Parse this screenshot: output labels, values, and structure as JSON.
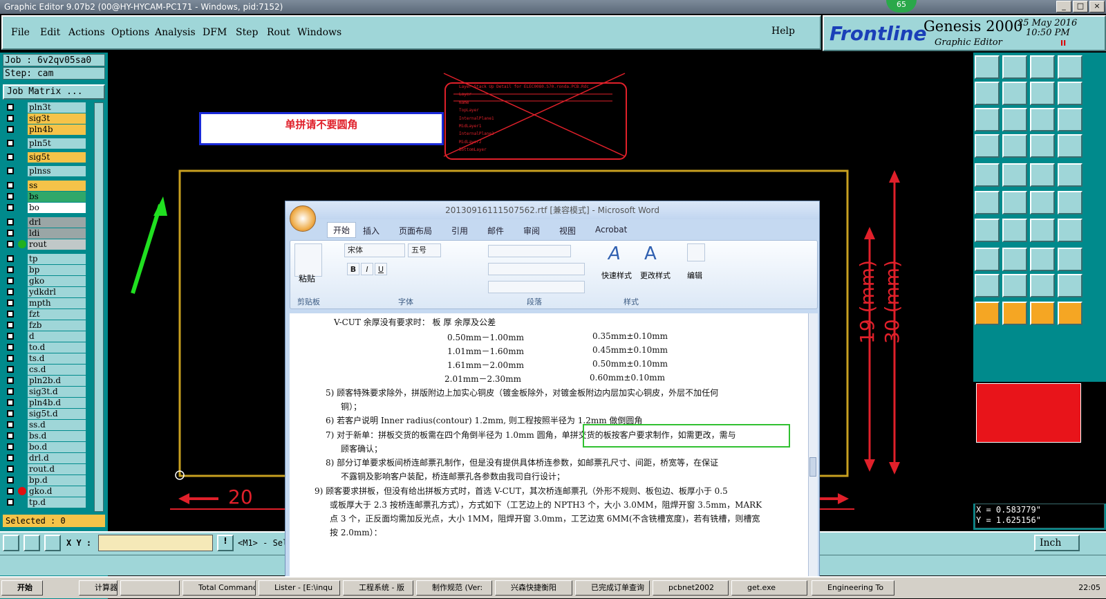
{
  "window": {
    "title": "Graphic Editor 9.07b2 (00@HY-HYCAM-PC171 - Windows, pid:7152)",
    "badge": "65",
    "min": "_",
    "max": "□",
    "close": "×"
  },
  "menu": {
    "items": [
      "File",
      "Edit",
      "Actions",
      "Options",
      "Analysis",
      "DFM",
      "Step",
      "Rout",
      "Windows"
    ],
    "help": "Help"
  },
  "brand": {
    "logo": "Frontline",
    "product": "Genesis 2000",
    "sub": "Graphic Editor",
    "date": "25 May 2016",
    "time": "10:50 PM",
    "icon": "II"
  },
  "job": {
    "job_label": "Job : 6v2qv05sa0",
    "step_label": "Step: cam",
    "matrix_button": "Job Matrix ...",
    "selected": "Selected : 0"
  },
  "layers": [
    {
      "name": "pln3t",
      "color": "#9fd6d8"
    },
    {
      "name": "sig3t",
      "color": "#f5c349"
    },
    {
      "name": "pln4b",
      "color": "#f5c349"
    },
    {
      "name": "pln5t",
      "color": "#9fd6d8"
    },
    {
      "name": "sig5t",
      "color": "#f5c349"
    },
    {
      "name": "plnss",
      "color": "#9fd6d8"
    },
    {
      "name": "ss",
      "color": "#f5c349"
    },
    {
      "name": "bs",
      "color": "#2fa86a"
    },
    {
      "name": "bo",
      "color": "#ffffff"
    },
    {
      "name": "drl",
      "color": "#9aa6a6"
    },
    {
      "name": "ldi",
      "color": "#9aa6a6"
    },
    {
      "name": "rout",
      "color": "#c0c8c8"
    },
    {
      "name": "tp",
      "color": "#9fd6d8"
    },
    {
      "name": "bp",
      "color": "#9fd6d8"
    },
    {
      "name": "gko",
      "color": "#9fd6d8"
    },
    {
      "name": "ydkdrl",
      "color": "#9fd6d8"
    },
    {
      "name": "mpth",
      "color": "#9fd6d8"
    },
    {
      "name": "fzt",
      "color": "#9fd6d8"
    },
    {
      "name": "fzb",
      "color": "#9fd6d8"
    },
    {
      "name": "d",
      "color": "#9fd6d8"
    },
    {
      "name": "to.d",
      "color": "#9fd6d8"
    },
    {
      "name": "ts.d",
      "color": "#9fd6d8"
    },
    {
      "name": "cs.d",
      "color": "#9fd6d8"
    },
    {
      "name": "pln2b.d",
      "color": "#9fd6d8"
    },
    {
      "name": "sig3t.d",
      "color": "#9fd6d8"
    },
    {
      "name": "pln4b.d",
      "color": "#9fd6d8"
    },
    {
      "name": "sig5t.d",
      "color": "#9fd6d8"
    },
    {
      "name": "ss.d",
      "color": "#9fd6d8"
    },
    {
      "name": "bs.d",
      "color": "#9fd6d8"
    },
    {
      "name": "bo.d",
      "color": "#9fd6d8"
    },
    {
      "name": "drl.d",
      "color": "#9fd6d8"
    },
    {
      "name": "rout.d",
      "color": "#9fd6d8"
    },
    {
      "name": "bp.d",
      "color": "#9fd6d8"
    },
    {
      "name": "gko.d",
      "color": "#9fd6d8"
    },
    {
      "name": "tp.d",
      "color": "#9fd6d8"
    }
  ],
  "canvas": {
    "note": "单拼请不要圆角",
    "dim_h": "20",
    "dim_v1": "19 (mm)",
    "dim_v2": "30 (mm)",
    "stackup": [
      "Layer Stack Up Detail for ELEC0080.S70.ronda.PCB.Rdc",
      [
        "Layer"
      ],
      [
        "Name"
      ],
      "TopLayer",
      "InternalPlane1",
      "MidLayer1",
      "InternalPlane2",
      "MidLayer2",
      "BottomLayer"
    ]
  },
  "coords": {
    "x": "X = 0.583779\"",
    "y": "Y = 1.625156\""
  },
  "bottom": {
    "xy_label": "X Y :",
    "xy_value": "",
    "status": "<M1> - Sel",
    "units": "Inch"
  },
  "word": {
    "title": "20130916111507562.rtf [兼容模式] - Microsoft Word",
    "tabs": [
      "开始",
      "插入",
      "页面布局",
      "引用",
      "邮件",
      "审阅",
      "视图",
      "Acrobat"
    ],
    "font": "宋体",
    "size": "五号",
    "groups": [
      "剪贴板",
      "字体",
      "段落",
      "样式",
      "编辑"
    ],
    "paste": "粘贴",
    "quick_style": "快速样式",
    "change_style": "更改样式",
    "edit": "编辑",
    "lines": [
      "V-CUT 余厚没有要求时：          板   厚                          余厚及公差",
      "0.50mm－1.00mm",
      "0.35mm±0.10mm",
      "1.01mm－1.60mm",
      "0.45mm±0.10mm",
      "1.61mm－2.00mm",
      "0.50mm±0.10mm",
      "2.01mm－2.30mm",
      "0.60mm±0.10mm",
      "5)   顾客特殊要求除外，拼版附边上加实心铜皮（镀金板除外，对镀金板附边内层加实心铜皮，外层不加任何",
      "铜）；",
      "6)   若客户说明 Inner radius(contour) 1.2mm, 则工程按照半径为 1.2mm 做倒圆角",
      "7)   对于新单：拼板交货的板需在四个角倒半径为 1.0mm 圆角，单拼交货的板按客户要求制作，如需更改，需与",
      "顾客确认；",
      "8)   部分订单要求板间桥连邮票孔制作，但是没有提供具体桥连参数，如邮票孔尺寸、间距，桥宽等，在保证",
      "不露铜及影响客户装配，桥连邮票孔各参数由我司自行设计；",
      "9)   顾客要求拼板，但没有给出拼板方式时，首选 V-CUT，其次桥连邮票孔（外形不规则、板包边、板厚小于 0.5",
      "或板厚大于 2.3 按桥连邮票孔方式），方式如下（工艺边上的 NPTH3 个，大小 3.0MM，阻焊开窗 3.5mm，MARK",
      "点 3 个，正反面均需加反光点，大小 1MM，阻焊开窗 3.0mm，工艺边宽 6MM(不含铣槽宽度)，若有铣槽，则槽宽",
      "按 2.0mm）："
    ]
  },
  "taskbar": {
    "start": "开始",
    "items": [
      "计算器",
      "",
      "Total Command",
      "Lister - [E:\\inqu",
      "工程系统 - 版",
      "制作规范 (Ver:",
      "兴森快捷衡阳",
      "已完成订单查询",
      "pcbnet2002",
      "get.exe",
      "Engineering To"
    ],
    "clock": "22:05"
  }
}
